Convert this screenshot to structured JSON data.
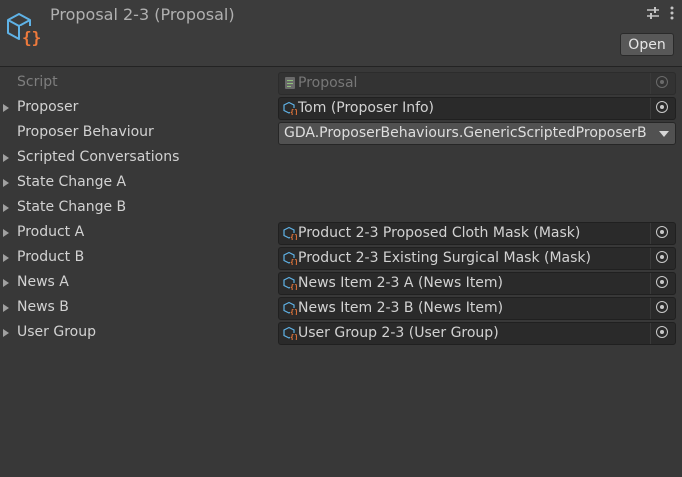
{
  "header": {
    "title": "Proposal 2-3 (Proposal)",
    "open_label": "Open",
    "asset_icon": "scriptable-object-icon",
    "settings_icon": "sliders-icon",
    "menu_icon": "vertical-ellipsis-icon"
  },
  "rows": [
    {
      "label": "Script",
      "value": "Proposal",
      "icon": "script-icon"
    },
    {
      "label": "Proposer",
      "value": "Tom (Proposer Info)",
      "icon": "scriptable-object-icon"
    },
    {
      "label": "Proposer Behaviour",
      "value": "GDA.ProposerBehaviours.GenericScriptedProposerB"
    },
    {
      "label": "Scripted Conversations"
    },
    {
      "label": "State Change A"
    },
    {
      "label": "State Change B"
    },
    {
      "label": "Product A",
      "value": "Product 2-3 Proposed Cloth Mask (Mask)",
      "icon": "scriptable-object-icon"
    },
    {
      "label": "Product B",
      "value": "Product 2-3 Existing Surgical Mask (Mask)",
      "icon": "scriptable-object-icon"
    },
    {
      "label": "News A",
      "value": "News Item 2-3 A (News Item)",
      "icon": "scriptable-object-icon"
    },
    {
      "label": "News B",
      "value": "News Item 2-3 B (News Item)",
      "icon": "scriptable-object-icon"
    },
    {
      "label": "User Group",
      "value": "User Group 2-3 (User Group)",
      "icon": "scriptable-object-icon"
    }
  ],
  "colors": {
    "background": "#383838",
    "header_background": "#3c3c3c",
    "field_background": "#2a2a2a",
    "icon_blue": "#5fb2e6",
    "icon_orange": "#ee7a3c"
  }
}
